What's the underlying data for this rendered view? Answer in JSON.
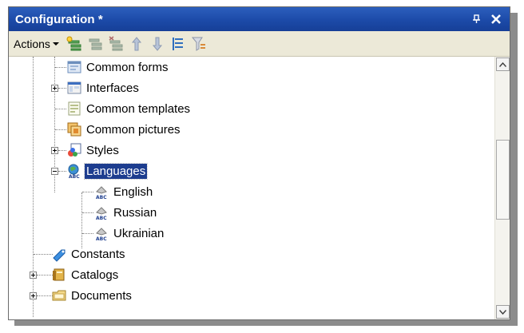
{
  "window": {
    "title": "Configuration *"
  },
  "toolbar": {
    "actions_label": "Actions",
    "tools": [
      {
        "icon": "add-item-icon"
      },
      {
        "icon": "add-subitem-icon"
      },
      {
        "icon": "delete-item-icon"
      },
      {
        "icon": "move-up-icon"
      },
      {
        "icon": "move-down-icon"
      },
      {
        "icon": "sort-icon"
      },
      {
        "icon": "filter-tree-icon"
      }
    ]
  },
  "tree": {
    "items": [
      {
        "label": "Common forms",
        "icon": "common-forms-icon"
      },
      {
        "label": "Interfaces",
        "icon": "interfaces-icon",
        "expandable": true,
        "expanded": false
      },
      {
        "label": "Common templates",
        "icon": "common-templates-icon"
      },
      {
        "label": "Common pictures",
        "icon": "common-pictures-icon"
      },
      {
        "label": "Styles",
        "icon": "styles-icon",
        "expandable": true,
        "expanded": false
      },
      {
        "label": "Languages",
        "icon": "languages-icon",
        "expandable": true,
        "expanded": true,
        "selected": true
      },
      {
        "label": "English",
        "icon": "language-icon"
      },
      {
        "label": "Russian",
        "icon": "language-icon"
      },
      {
        "label": "Ukrainian",
        "icon": "language-icon"
      },
      {
        "label": "Constants",
        "icon": "constants-icon"
      },
      {
        "label": "Catalogs",
        "icon": "catalogs-icon",
        "expandable": true,
        "expanded": false
      },
      {
        "label": "Documents",
        "icon": "documents-icon",
        "expandable": true,
        "expanded": false
      }
    ]
  },
  "colors": {
    "title_bar": "#1c4aa8",
    "selection": "#1d3d8f",
    "toolbar_bg": "#ece9d8"
  }
}
